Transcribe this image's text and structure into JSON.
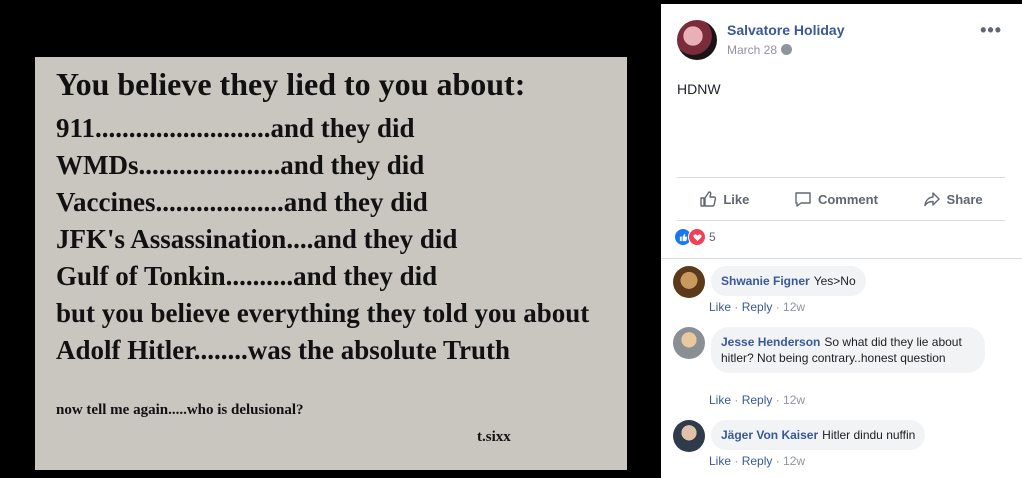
{
  "meme": {
    "headline": "You believe they lied to you about:",
    "lines": [
      "911..........................and they did",
      "WMDs.....................and they did",
      "Vaccines...................and they did",
      "JFK's Assassination....and they did",
      "Gulf of Tonkin..........and they did",
      "but you believe everything they told you about",
      "Adolf Hitler........was the absolute Truth"
    ],
    "closing": "now tell me again.....who is delusional?",
    "signature": "t.sixx"
  },
  "post": {
    "author": "Salvatore Holiday",
    "date": "March 28",
    "text": "HDNW"
  },
  "actions": {
    "like": "Like",
    "comment": "Comment",
    "share": "Share"
  },
  "reactions": {
    "count": "5"
  },
  "comments": [
    {
      "name": "Shwanie Figner",
      "text": "Yes>No",
      "like": "Like",
      "reply": "Reply",
      "age": "12w"
    },
    {
      "name": "Jesse Henderson",
      "text": "So what did they lie about hitler? Not being contrary..honest question",
      "like": "Like",
      "reply": "Reply",
      "age": "12w"
    },
    {
      "name": "Jäger Von Kaiser",
      "text": "Hitler dindu nuffin",
      "like": "Like",
      "reply": "Reply",
      "age": "12w"
    }
  ],
  "colors": {
    "link": "#385898",
    "meta": "#90949c",
    "like_blue": "#1877f2",
    "love_red": "#f33e58"
  }
}
